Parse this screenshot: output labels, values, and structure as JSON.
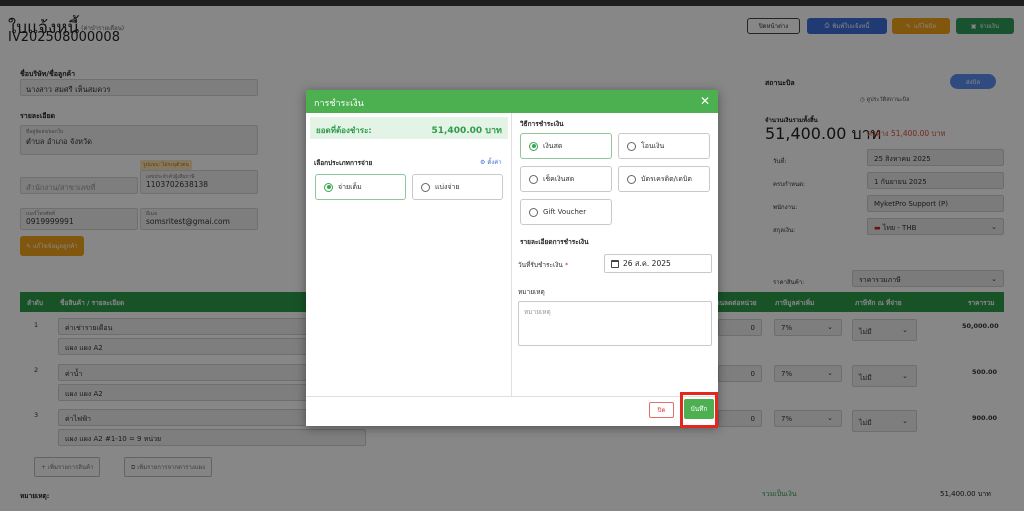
{
  "header": {
    "title": "ใบแจ้งหนี้",
    "title_sub": "(ค่าบำรายเดือน)",
    "doc_number": "IV202508000008",
    "buttons": {
      "close": "ปิดหน้าต่าง",
      "print": "พิมพ์ใบแจ้งหนี้",
      "edit": "แก้ไขบิล",
      "pay": "จ่ายเงิน"
    }
  },
  "customer": {
    "name_label": "ชื่อบริษัท/ชื่อลูกค้า",
    "name_value": "นางสาว สมศรี เห็นสมควร",
    "details_label": "รายละเอียด",
    "address_sub": "ที่อยู่จัดส่ง/ออกใบ",
    "address_value": "ตำบล อำเภอ จังหวัด",
    "branch_placeholder": "สำนักงาน/สาขาเลขที่",
    "tax_badge": "รูปแบบ: ไม่ระบุตัวตน",
    "tax_sub": "เลขประจำตัวผู้เสียภาษี",
    "tax_value": "1103702638138",
    "phone_sub": "เบอร์โทรศัพท์",
    "phone_value": "0919999991",
    "email_sub": "อีเมล",
    "email_value": "somsritest@gmai.com",
    "edit_button": "แก้ไขข้อมูลลูกค้า"
  },
  "status": {
    "label": "สถานะบิล",
    "badge": "ส่งบิล",
    "history_link": "ดูประวัติสถานะบิล",
    "total_label": "จำนวนเงินรวมทั้งสิ้น",
    "total_value": "51,400.00 บาท",
    "outstanding": "คงค้าง 51,400.00 บาท",
    "date_label": "วันที่:",
    "date_value": "25 สิงหาคม 2025",
    "due_label": "ครบกำหนด:",
    "due_value": "1 กันยายน 2025",
    "staff_label": "พนักงาน:",
    "staff_value": "MyketPro Support (P)",
    "currency_label": "สกุลเงิน:",
    "currency_value": "ไทย - THB",
    "price_type_label": "ราคาสินค้า:",
    "price_type_value": "ราคารวมภาษี"
  },
  "table": {
    "headers": {
      "no": "ลำดับ",
      "item": "ชื่อสินค้า / รายละเอียด",
      "discount": "ส่วนลดต่อหน่วย",
      "vat": "ภาษีมูลค่าเพิ่ม",
      "wht": "ภาษีหัก ณ ที่จ่าย",
      "total": "ราคารวม"
    },
    "rows": [
      {
        "no": "1",
        "name": "ค่าเช่ารายเดือน",
        "detail": "แผง แผง A2",
        "discount": "0",
        "vat": "7%",
        "wht": "ไม่มี",
        "amount": "50,000.00"
      },
      {
        "no": "2",
        "name": "ค่าน้ำ",
        "detail": "แผง แผง A2",
        "discount": "0",
        "vat": "7%",
        "wht": "ไม่มี",
        "amount": "500.00"
      },
      {
        "no": "3",
        "name": "ค่าไฟฟ้า",
        "detail": "แผง แผง A2 #1-10 = 9 หน่วย",
        "discount": "0",
        "vat": "7%",
        "wht": "ไม่มี",
        "amount": "900.00"
      }
    ],
    "add_item": "เพิ่มรายการสินค้า",
    "add_from_template": "เพิ่มรายการจากตารางแผง",
    "note_label": "หมายเหตุ:",
    "sum_label": "รวมเป็นเงิน",
    "sum_value": "51,400.00 บาท"
  },
  "modal": {
    "title": "การชำระเงิน",
    "close_symbol": "✕",
    "due_label": "ยอดที่ต้องชำระ:",
    "due_value": "51,400.00 บาท",
    "pay_type_title": "เลือกประเภทการจ่าย",
    "settings_link": "ตั้งค่า",
    "pay_types": [
      "จ่ายเต็ม",
      "แบ่งจ่าย"
    ],
    "method_title": "วิธีการชำระเงิน",
    "methods": [
      "เงินสด",
      "โอนเงิน",
      "เช็คเงินสด",
      "บัตรเครดิต/เดบิต",
      "Gift Voucher"
    ],
    "details_title": "รายละเอียดการชำระเงิน",
    "date_label": "วันที่รับชำระเงิน",
    "required_mark": "*",
    "date_value": "26 ส.ค. 2025",
    "note_label": "หมายเหตุ",
    "note_placeholder": "หมายเหตุ",
    "cancel_button": "ปิด",
    "save_button": "บันทึก"
  }
}
